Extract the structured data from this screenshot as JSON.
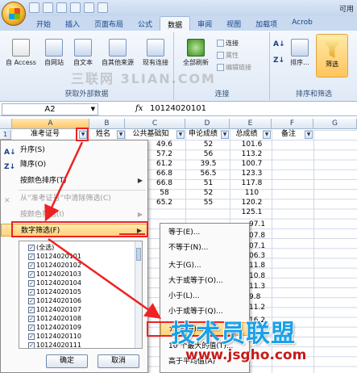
{
  "window": {
    "title_fragment": "可用"
  },
  "ribbon": {
    "tabs": [
      "开始",
      "插入",
      "页面布局",
      "公式",
      "数据",
      "审阅",
      "视图",
      "加载项",
      "Acrob"
    ],
    "active_tab": "数据",
    "external_data": {
      "access": "自 Access",
      "web": "自网站",
      "text": "自文本",
      "other": "自其他来源",
      "existing": "现有连接",
      "title": "获取外部数据"
    },
    "connections": {
      "refresh": "全部刷新",
      "connections": "连接",
      "properties": "属性",
      "edit_links": "编辑链接",
      "title": "连接"
    },
    "sort_filter": {
      "sort": "排序...",
      "filter": "筛选",
      "title": "排序和筛选"
    },
    "watermark": "三联网 3LIAN.COM"
  },
  "formula_bar": {
    "name_box": "A2",
    "fx": "fx",
    "value": "10124020101"
  },
  "columns": [
    "A",
    "B",
    "C",
    "D",
    "E",
    "F",
    "G"
  ],
  "header_row": {
    "row": "1",
    "cells": [
      "准考证号",
      "姓名",
      "公共基础知",
      "申论成绩",
      "总成绩",
      "备注"
    ]
  },
  "data_rows": [
    {
      "c": "49.6",
      "d": "52",
      "e": "101.6"
    },
    {
      "c": "57.2",
      "d": "56",
      "e": "113.2"
    },
    {
      "c": "61.2",
      "d": "39.5",
      "e": "100.7"
    },
    {
      "c": "66.8",
      "d": "56.5",
      "e": "123.3"
    },
    {
      "c": "66.8",
      "d": "51",
      "e": "117.8"
    },
    {
      "c": "58",
      "d": "52",
      "e": "110"
    },
    {
      "c": "65.2",
      "d": "55",
      "e": "120.2"
    },
    {
      "c": "",
      "d": "",
      "e": "125.1"
    }
  ],
  "partial_values": [
    "97.1",
    "07.8",
    "07.1",
    "06.3",
    "11.8",
    "10.8",
    "11.3",
    "9.8",
    "11.2",
    "16.2"
  ],
  "filter_menu": {
    "items": [
      {
        "icon": "A↓",
        "label": "升序(S)"
      },
      {
        "icon": "Z↓",
        "label": "降序(O)"
      },
      {
        "label": "按颜色排序(T)",
        "arrow": "▶"
      },
      {
        "label": "从“准考证号”中清除筛选(C)",
        "dim": true
      },
      {
        "label": "按颜色筛选(I)",
        "dim": true,
        "arrow": "▶"
      },
      {
        "label": "数字筛选(F)",
        "arrow": "▶",
        "highlight": true
      }
    ],
    "checklist": [
      "(全选)",
      "10124020101",
      "10124020102",
      "10124020103",
      "10124020104",
      "10124020105",
      "10124020106",
      "10124020107",
      "10124020108",
      "10124020109",
      "10124020110",
      "10124020111"
    ],
    "ok": "确定",
    "cancel": "取消"
  },
  "number_filter_submenu": {
    "items": [
      "等于(E)...",
      "不等于(N)...",
      "大于(G)...",
      "大于或等于(O)...",
      "小于(L)...",
      "小于或等于(Q)...",
      "介于(W)...",
      "10 个最大的值(T)...",
      "高于平均值(A)"
    ]
  },
  "branding": {
    "name": "技术员联盟",
    "url": "www.jsgho.com"
  }
}
